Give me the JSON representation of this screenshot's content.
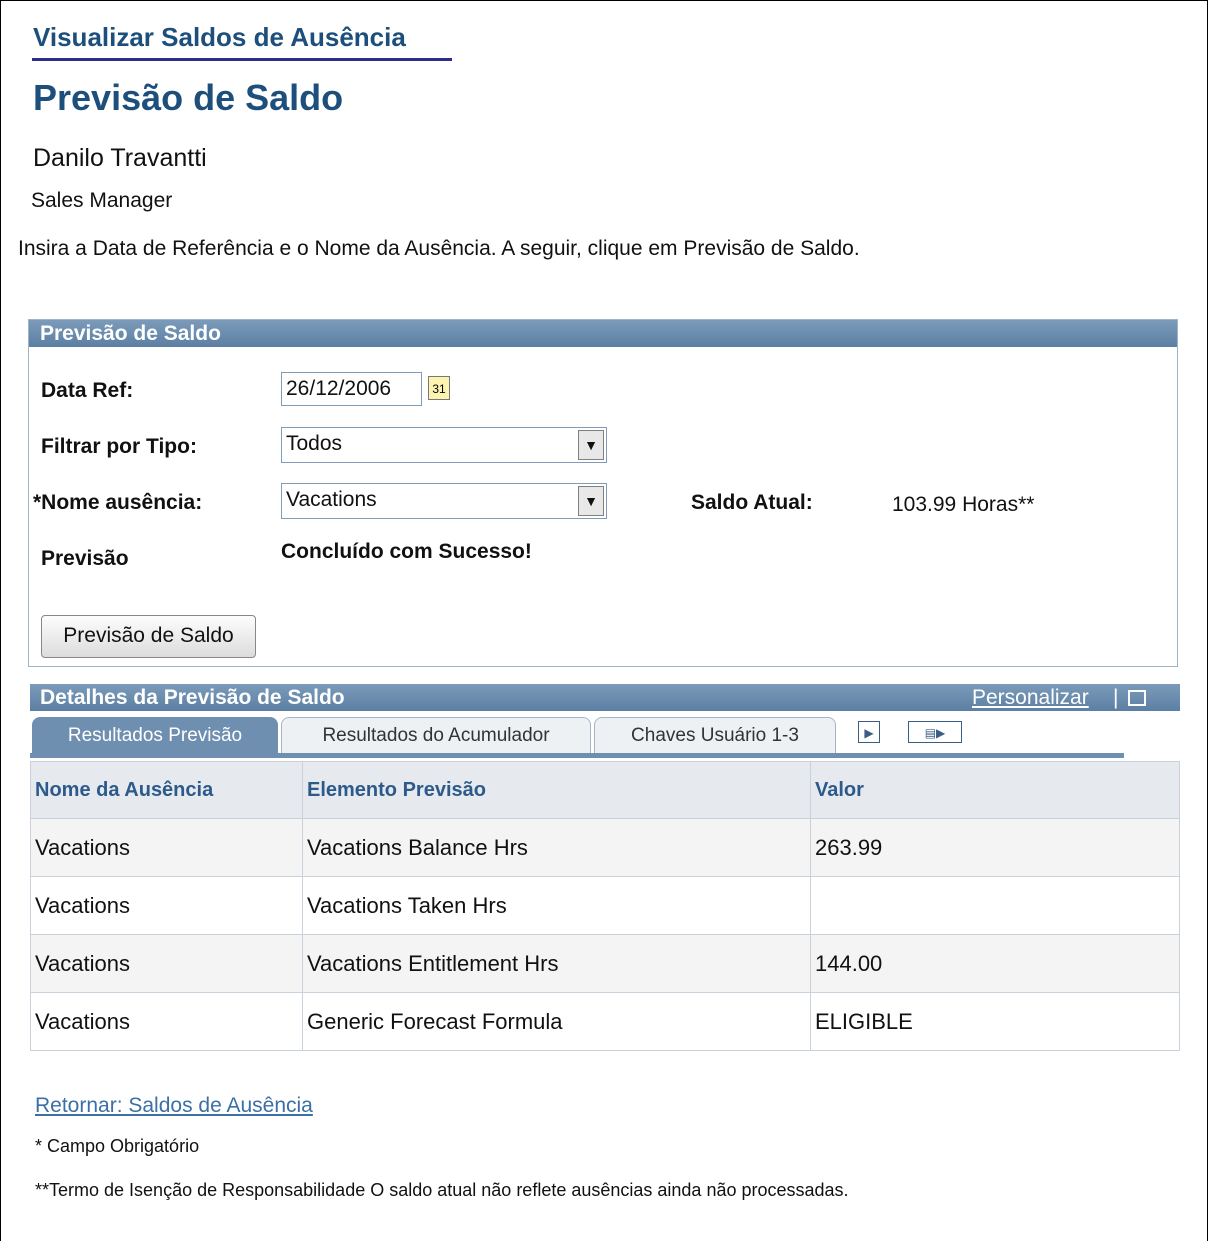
{
  "header": {
    "title": "Visualizar Saldos de Ausência",
    "subtitle": "Previsão de Saldo",
    "employee_name": "Danilo Travantti",
    "employee_title": "Sales Manager",
    "instructions": "Insira a Data de Referência e o Nome da Ausência. A seguir, clique em Previsão de Saldo."
  },
  "form": {
    "group_title": "Previsão de Saldo",
    "date_label": "Data Ref:",
    "date_value": "26/12/2006",
    "calendar_icon_text": "31",
    "filter_label": "Filtrar por Tipo:",
    "filter_value": "Todos",
    "absence_label": "*Nome ausência:",
    "absence_value": "Vacations",
    "balance_label": "Saldo Atual:",
    "balance_value": "103.99 Horas**",
    "forecast_label": "Previsão",
    "forecast_status": "Concluído com Sucesso!",
    "forecast_button": "Previsão de Saldo"
  },
  "grid": {
    "title": "Detalhes da Previsão de Saldo",
    "personalize": "Personalizar",
    "separator": "|",
    "tabs": [
      "Resultados Previsão",
      "Resultados do Acumulador",
      "Chaves Usuário 1-3"
    ],
    "columns": [
      "Nome da Ausência",
      "Elemento Previsão",
      "Valor"
    ],
    "rows": [
      [
        "Vacations",
        "Vacations Balance Hrs",
        "263.99"
      ],
      [
        "Vacations",
        "Vacations Taken Hrs",
        ""
      ],
      [
        "Vacations",
        "Vacations Entitlement Hrs",
        "144.00"
      ],
      [
        "Vacations",
        "Generic Forecast Formula",
        "ELIGIBLE"
      ]
    ]
  },
  "footer": {
    "return_link": "Retornar: Saldos de Ausência",
    "required_note": "* Campo Obrigatório",
    "disclaimer": "**Termo de Isenção de Responsabilidade O saldo atual não reflete ausências ainda não processadas."
  }
}
